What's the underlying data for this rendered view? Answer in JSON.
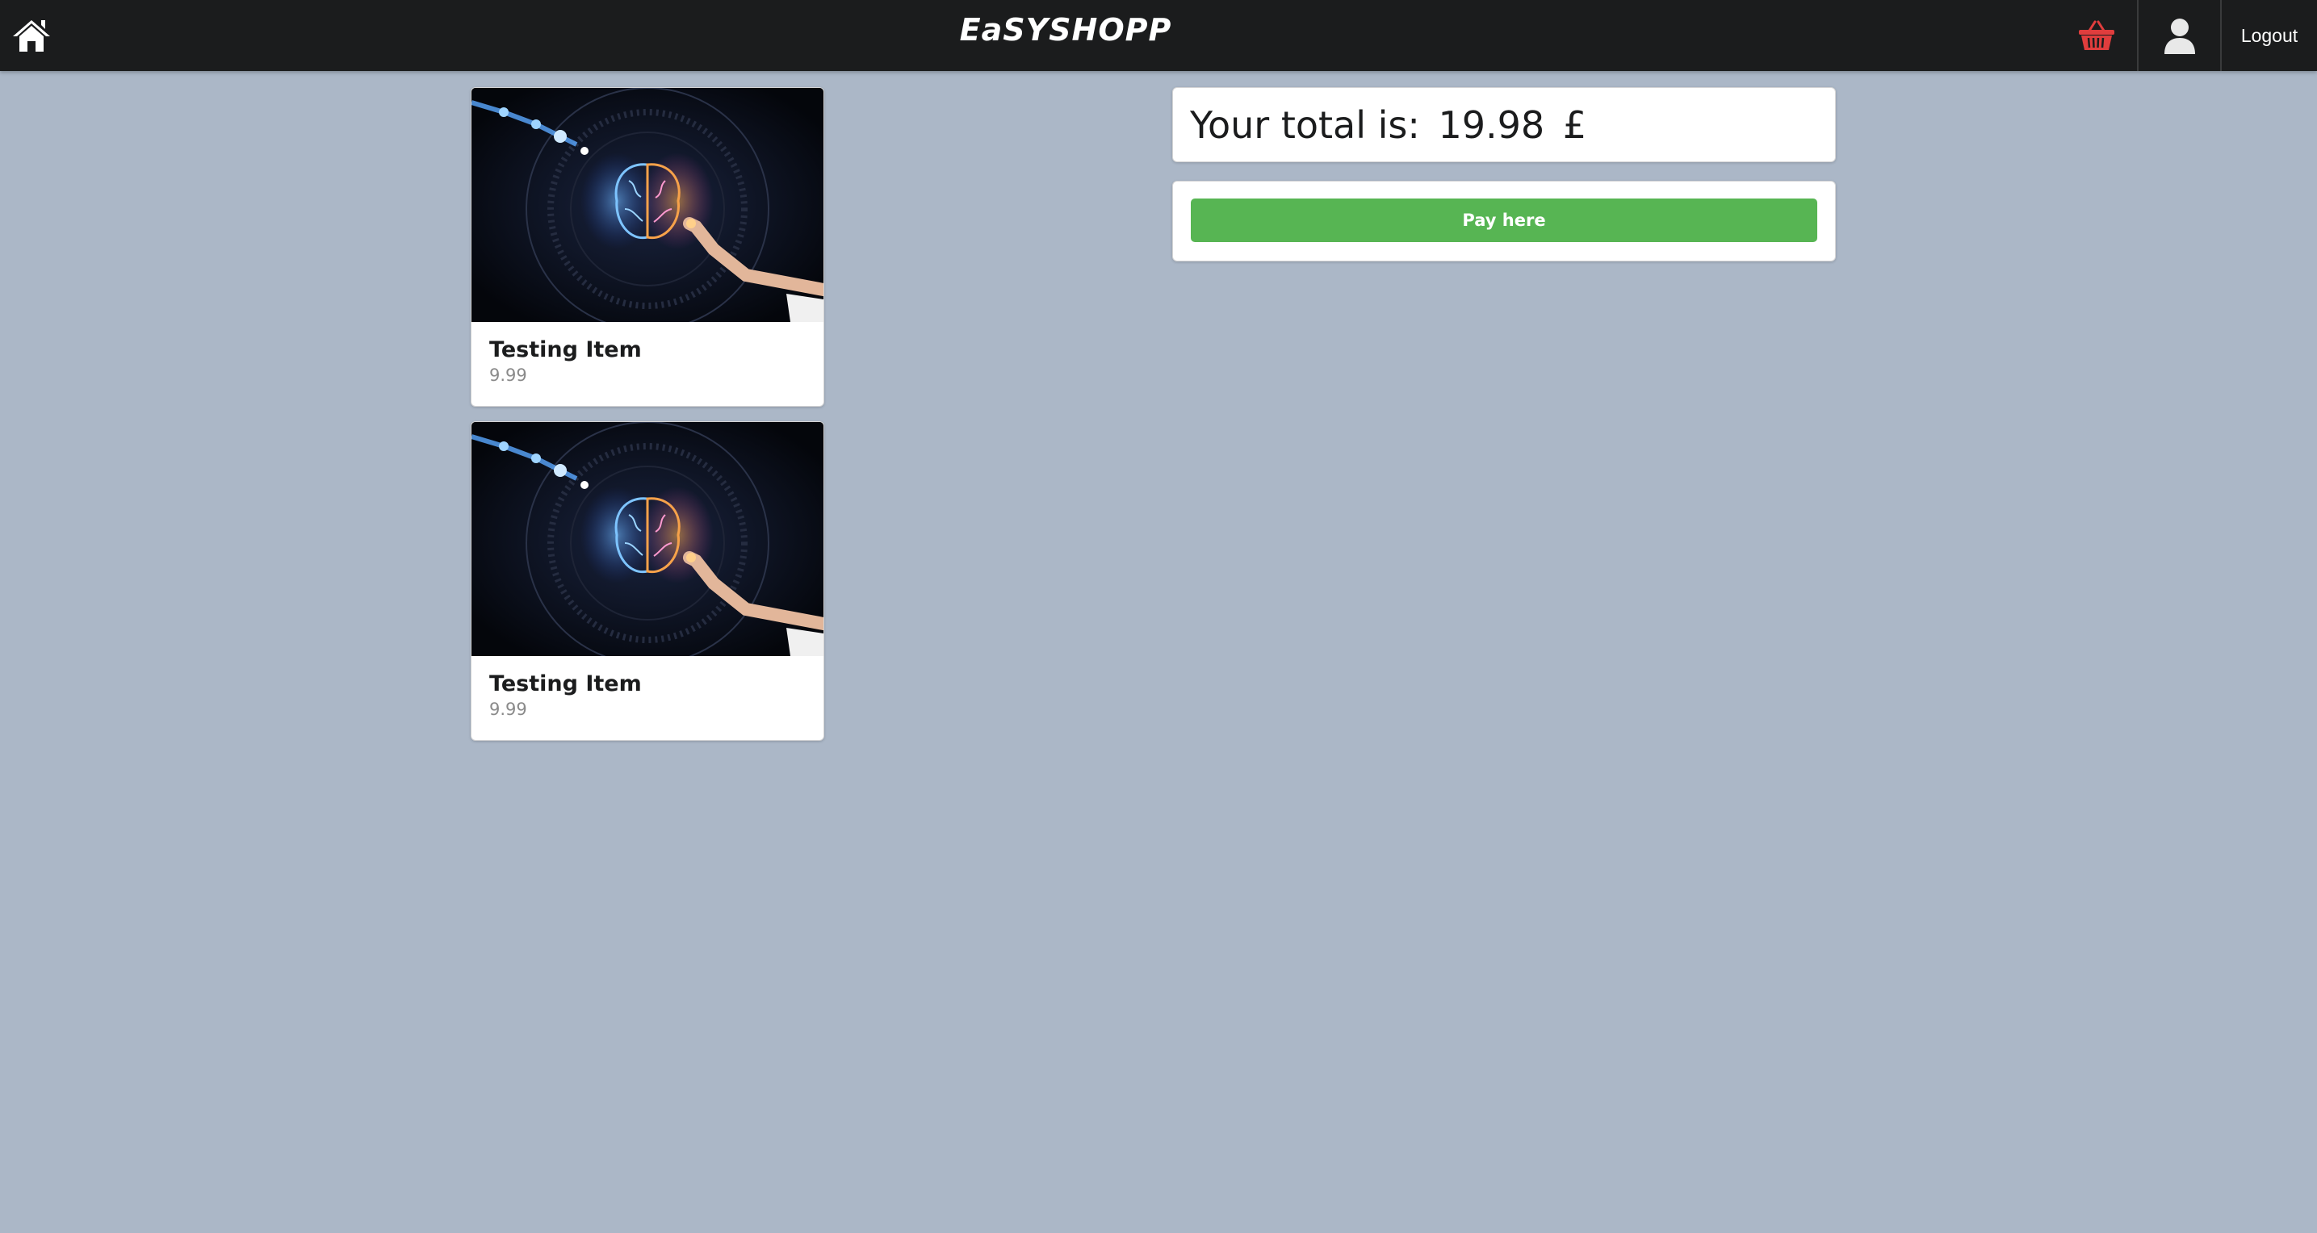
{
  "navbar": {
    "brand": "EaSYSHOPP",
    "logout_label": "Logout",
    "cart_color": "#e03d3d"
  },
  "cart_items": [
    {
      "title": "Testing Item",
      "price": "9.99",
      "image": "ai-brain-hand-image"
    },
    {
      "title": "Testing Item",
      "price": "9.99",
      "image": "ai-brain-hand-image"
    }
  ],
  "summary": {
    "total_label": "Your total is:",
    "total_value": "19.98",
    "currency": "£",
    "pay_label": "Pay here"
  },
  "colors": {
    "background": "#abb7c7",
    "navbar": "#1b1c1d",
    "pay_button": "#57b553"
  }
}
